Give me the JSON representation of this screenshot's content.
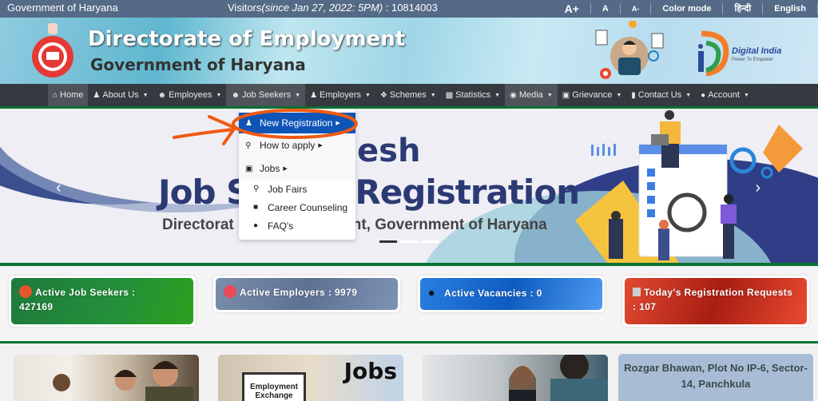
{
  "topbar": {
    "gov_label": "Government of Haryana",
    "visitors_prefix": "Visitors",
    "visitors_since": "(since Jan 27, 2022: 5PM)",
    "visitors_count": " : 10814003",
    "tools": [
      "A+",
      "A",
      "A-",
      "Color mode",
      "हिन्दी",
      "English"
    ]
  },
  "header": {
    "title": "Directorate of Employment",
    "subtitle": "Government of Haryana",
    "digital_india": "Digital India",
    "digital_india_tagline": "Power To Empower"
  },
  "nav": {
    "items": [
      {
        "label": "Home",
        "icon": "home-icon",
        "caret": false
      },
      {
        "label": "About Us",
        "icon": "sitemap-icon",
        "caret": true
      },
      {
        "label": "Employees",
        "icon": "users-icon",
        "caret": true
      },
      {
        "label": "Job Seekers",
        "icon": "users-icon",
        "caret": true
      },
      {
        "label": "Employers",
        "icon": "sitemap-icon",
        "caret": true
      },
      {
        "label": "Schemes",
        "icon": "puzzle-icon",
        "caret": true
      },
      {
        "label": "Statistics",
        "icon": "bar-chart-icon",
        "caret": true
      },
      {
        "label": "Media",
        "icon": "camera-icon",
        "caret": true
      },
      {
        "label": "Grievance",
        "icon": "comment-icon",
        "caret": true
      },
      {
        "label": "Contact Us",
        "icon": "mobile-icon",
        "caret": true
      },
      {
        "label": "Account",
        "icon": "user-icon",
        "caret": true
      }
    ]
  },
  "dropdown": {
    "items": [
      {
        "label": "New Registration",
        "icon": "person-icon",
        "caret": true
      },
      {
        "label": "How to apply",
        "icon": "search-icon",
        "caret": true
      },
      {
        "label": "Jobs",
        "icon": "briefcase-icon",
        "caret": true
      },
      {
        "label": "Job Fairs",
        "icon": "search-person-icon",
        "caret": false
      },
      {
        "label": "Career Counseling",
        "icon": "counseling-icon",
        "caret": false
      },
      {
        "label": "FAQ's",
        "icon": "comments-icon",
        "caret": false
      }
    ]
  },
  "banner": {
    "heading_visible": "esh",
    "heading_big_left": "Job S",
    "heading_big_right": "Registration",
    "sub_left": "Directorat",
    "sub_right": "nt, Government of Haryana"
  },
  "stats": {
    "cards": [
      {
        "label": "Active Job Seekers :",
        "value": "427169",
        "color": "#1f8c3a"
      },
      {
        "label": "Active Employers :",
        "value": "9979",
        "color": "#6f84a4"
      },
      {
        "label": "Active Vacancies :",
        "value": "0",
        "color": "#1f6fd0"
      },
      {
        "label": "Today's Registration Requests :",
        "value": "107",
        "color": "#d63a2a"
      }
    ]
  },
  "bottom": {
    "jobs_text": "Jobs",
    "exchange_text": "Employment Exchange",
    "address": "Rozgar Bhawan, Plot No IP-6, Sector- 14, Panchkula"
  },
  "annotation_color": "#f05a12"
}
